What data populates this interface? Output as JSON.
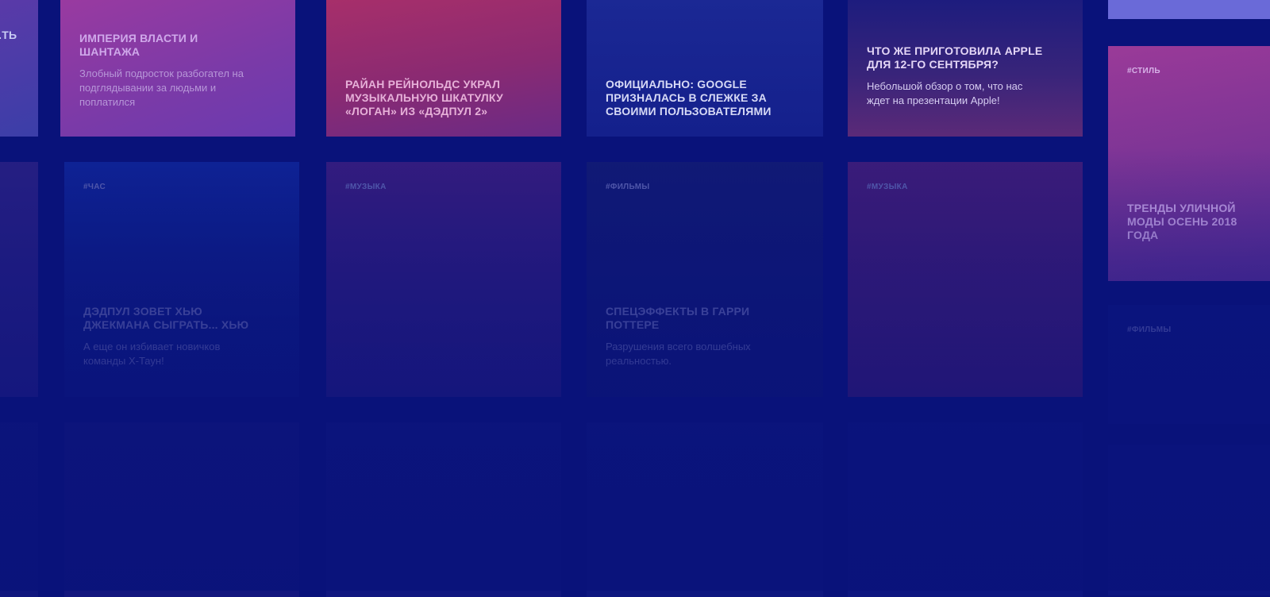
{
  "colors": {
    "background": "#09127a",
    "card_pink": "#7a2a8e",
    "card_red": "#8a2660",
    "card_dark": "#0d1a86"
  },
  "cards": {
    "c_partial_left": {
      "title": "...ТЬ"
    },
    "c_empire": {
      "title": "ИМПЕРИЯ ВЛАСТИ И ШАНТАЖА",
      "desc": "Злобный подросток разбогател на подглядывании за людьми и поплатился"
    },
    "c_ryan": {
      "title": "РАЙАН РЕЙНОЛЬДС УКРАЛ МУЗЫКАЛЬНУЮ ШКАТУЛКУ «ЛОГАН» ИЗ «ДЭДПУЛ 2»"
    },
    "c_google": {
      "title": "ОФИЦИАЛЬНО: GOOGLE ПРИЗНАЛАСЬ В СЛЕЖКЕ ЗА СВОИМИ ПОЛЬЗОВАТЕЛЯМИ"
    },
    "c_apple": {
      "title": "ЧТО ЖЕ ПРИГОТОВИЛА APPLE ДЛЯ 12-ГО СЕНТЯБРЯ?",
      "desc": "Небольшой обзор о том, что нас ждет на презентации Apple!"
    },
    "c_style": {
      "tag": "#СТИЛЬ",
      "title": "ТРЕНДЫ УЛИЧНОЙ МОДЫ ОСЕНЬ 2018 ГОДА"
    },
    "c_deadpool": {
      "tag": "#ЧАС",
      "title": "ДЭДПУЛ ЗОВЕТ ХЬЮ ДЖЕКМАНА СЫГРАТЬ... ХЬЮ",
      "desc": "А еще он избивает новичков команды Х-Таун!"
    },
    "c_music1": {
      "tag": "#МУЗЫКА"
    },
    "c_harry": {
      "tag": "#ФИЛЬМЫ",
      "title": "СПЕЦЭФФЕКТЫ В ГАРРИ ПОТТЕРЕ",
      "desc": "Разрушения всего волшебных реальностью."
    },
    "c_music2": {
      "tag": "#МУЗЫКА"
    },
    "c_films_right": {
      "tag": "#ФИЛЬМЫ"
    }
  }
}
